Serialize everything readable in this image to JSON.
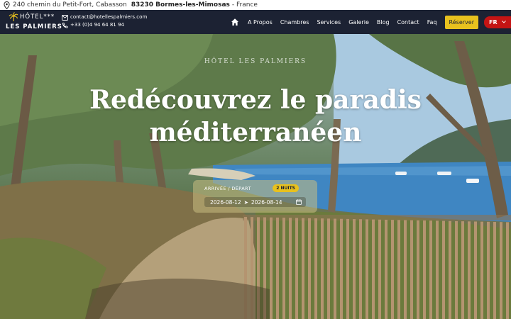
{
  "topbar": {
    "street": "240 chemin du Petit-Fort, Cabasson",
    "city": "83230 Bormes-les-Mimosas",
    "country": "- France",
    "icon": "map-pin-icon"
  },
  "logo": {
    "line1": "HÔTEL***",
    "line2": "LES PALMIERS"
  },
  "contact": {
    "email": "contact@hotellespalmiers.com",
    "phone": "+33 (0)4 94 64 81 94"
  },
  "nav": {
    "items": [
      "A Propos",
      "Chambres",
      "Services",
      "Galerie",
      "Blog",
      "Contact",
      "Faq"
    ],
    "book": "Réserver",
    "lang": "FR"
  },
  "hero": {
    "kicker": "HÔTEL LES PALMIERS",
    "title": "Redécouvrez le paradis méditerranéen"
  },
  "booking": {
    "label": "ARRIVÉE / DÉPART",
    "nights": "2 NUITS",
    "arrival": "2026-08-12",
    "arrow": "➤",
    "departure": "2026-08-14"
  },
  "colors": {
    "nav_bg": "#1c2233",
    "accent": "#e8c11e",
    "lang_bg": "#c41414"
  }
}
